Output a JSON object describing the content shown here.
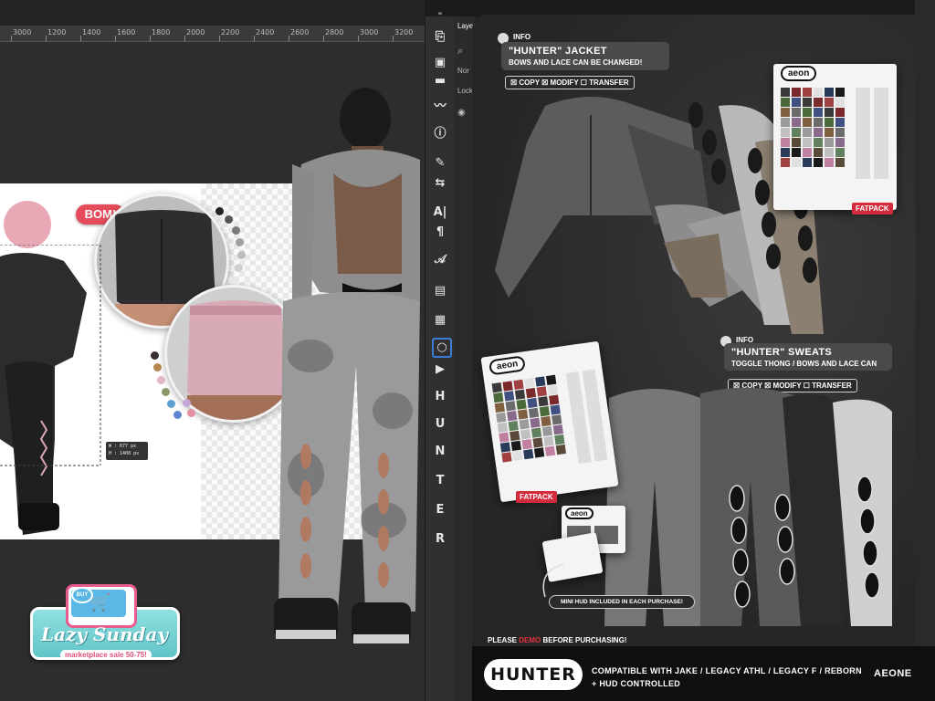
{
  "ruler_ticks": [
    "3000",
    "1200",
    "1400",
    "1600",
    "1800",
    "2000",
    "2200",
    "2400",
    "2600",
    "2800",
    "3000",
    "3200"
  ],
  "toolbar": {
    "collapse_label": "«",
    "tools": [
      {
        "name": "history-icon",
        "glyph": "⎘"
      },
      {
        "name": "stamp-icon",
        "glyph": "▣"
      },
      {
        "name": "comment-icon",
        "glyph": "▬"
      },
      {
        "name": "brush-settings-icon",
        "glyph": "〰"
      },
      {
        "name": "info-icon",
        "glyph": "ⓘ"
      },
      {
        "name": "brush-icon",
        "glyph": "✎"
      },
      {
        "name": "adjust-icon",
        "glyph": "⇆"
      },
      {
        "name": "character-icon",
        "glyph": "A|"
      },
      {
        "name": "paragraph-icon",
        "glyph": "¶"
      },
      {
        "name": "glyphs-icon",
        "glyph": "𝒜"
      },
      {
        "name": "navigator-icon",
        "glyph": "▤"
      },
      {
        "name": "notes-icon",
        "glyph": "▦"
      },
      {
        "name": "shape-icon",
        "glyph": "○"
      },
      {
        "name": "play-icon",
        "glyph": "▶"
      },
      {
        "name": "letter-h-icon",
        "glyph": "H"
      },
      {
        "name": "letter-u-icon",
        "glyph": "U"
      },
      {
        "name": "letter-n-icon",
        "glyph": "N"
      },
      {
        "name": "letter-t-icon",
        "glyph": "T"
      },
      {
        "name": "letter-e-icon",
        "glyph": "E"
      },
      {
        "name": "letter-r-icon",
        "glyph": "R"
      }
    ]
  },
  "layers_panel": {
    "title": "Laye",
    "search": "⌕",
    "mode": "Nor",
    "lock": "Lock",
    "eye": "◉"
  },
  "canvas": {
    "bom_label": "BOM!",
    "measure_w": "W : 677 px",
    "measure_h": "H : 1408 px"
  },
  "jacket": {
    "info_label": "INFO",
    "title": "\"HUNTER\" JACKET",
    "subtitle": "BOWS AND LACE CAN BE CHANGED!",
    "permissions": "☒ COPY  ☒ MODIFY  ☐ TRANSFER",
    "fatpack": "FATPACK",
    "logo": "aeon"
  },
  "sweats": {
    "info_label": "INFO",
    "title": "\"HUNTER\" SWEATS",
    "subtitle": "TOGGLE THONG / BOWS AND LACE CAN",
    "permissions": "☒ COPY  ☒ MODIFY  ☐ TRANSFER",
    "fatpack": "FATPACK",
    "logo": "aeon"
  },
  "mini_hud": {
    "caption": "MINI HUD INCLUDED IN EACH PURCHASE!",
    "logo": "aeon"
  },
  "demo": {
    "prefix": "PLEASE ",
    "highlight": "DEMO",
    "suffix": " BEFORE PURCHASING!"
  },
  "footer": {
    "product": "HUNTER",
    "compat_line1": "COMPATIBLE WITH JAKE / LEGACY ATHL / LEGACY F / REBORN",
    "compat_line2": "+ HUD CONTROLLED",
    "brand": "AEONE"
  },
  "lazy_sunday": {
    "buy": "BUY",
    "title": "Lazy Sunday",
    "subtitle": "marketplace sale 50-75!"
  },
  "colors": {
    "accent_red": "#d22b3b",
    "bom_red": "#e54b5a",
    "panel_dark": "#2a2a2a",
    "selection_blue": "#3a7bd5"
  }
}
